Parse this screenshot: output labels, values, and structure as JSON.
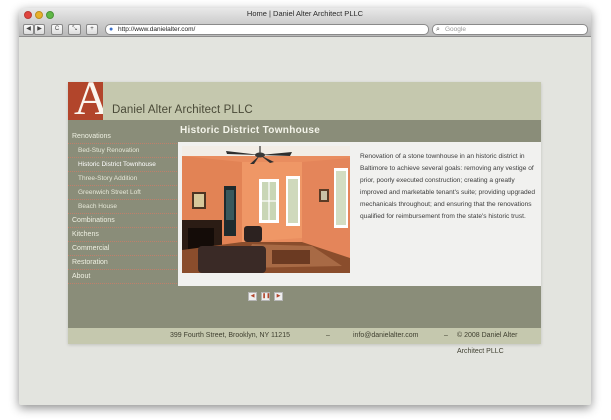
{
  "browser": {
    "title": "Home | Daniel Alter Architect PLLC",
    "url": "http://www.danielalter.com/",
    "search_placeholder": "Google",
    "buttons": {
      "back": "◀",
      "forward": "▶",
      "reload": "C",
      "shrink": "⤡",
      "add": "+"
    }
  },
  "site": {
    "logo_letter": "A",
    "brand": "Daniel Alter Architect PLLC",
    "page_title": "Historic District Townhouse",
    "nav": [
      {
        "label": "Renovations",
        "level": 1
      },
      {
        "label": "Bed-Stuy Renovation",
        "level": 2
      },
      {
        "label": "Historic District Townhouse",
        "level": 2
      },
      {
        "label": "Three-Story Addition",
        "level": 2
      },
      {
        "label": "Greenwich Street Loft",
        "level": 2
      },
      {
        "label": "Beach House",
        "level": 2
      },
      {
        "label": "Combinations",
        "level": 1
      },
      {
        "label": "Kitchens",
        "level": 1
      },
      {
        "label": "Commercial",
        "level": 1
      },
      {
        "label": "Restoration",
        "level": 1
      },
      {
        "label": "About",
        "level": 1
      }
    ],
    "description": "Renovation of a stone townhouse in an historic district in Baltimore to achieve several goals: removing any vestige of prior, poorly executed construction; creating a greatly improved and marketable tenant's suite; providing upgraded mechanicals throughout; and ensuring that the renovations qualified for reimbursement from the state's historic trust.",
    "slideshow": {
      "prev": "◀",
      "pause": "❚❚",
      "next": "▶"
    },
    "footer": {
      "address": "399 Fourth Street,  Brooklyn, NY 11215",
      "sep1": "–",
      "email": "info@danielalter.com",
      "sep2": "–",
      "copyright": "© 2008 Daniel Alter Architect PLLC"
    }
  },
  "colors": {
    "accent": "#b2452b",
    "header": "#c5c8ae",
    "body": "#8a8d79"
  }
}
